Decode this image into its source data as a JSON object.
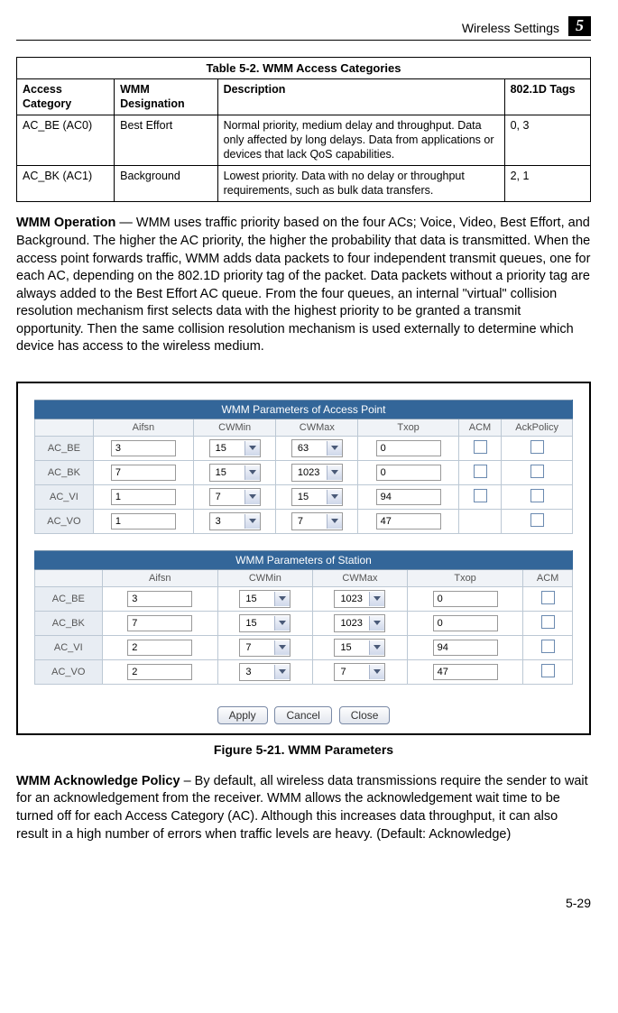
{
  "header": {
    "section_title": "Wireless Settings",
    "chapter_number": "5"
  },
  "table52": {
    "caption": "Table 5-2. WMM Access Categories",
    "headers": [
      "Access Category",
      "WMM Designation",
      "Description",
      "802.1D Tags"
    ],
    "rows": [
      {
        "category": "AC_BE (AC0)",
        "designation": "Best Effort",
        "description": "Normal priority, medium delay and throughput. Data only affected by long delays. Data from applications or devices that lack QoS capabilities.",
        "tags": "0, 3"
      },
      {
        "category": "AC_BK (AC1)",
        "designation": "Background",
        "description": "Lowest priority. Data with no delay or throughput requirements, such as bulk data transfers.",
        "tags": "2, 1"
      }
    ]
  },
  "para1": {
    "heading": "WMM Operation",
    "text": " — WMM uses traffic priority based on the four ACs; Voice, Video, Best Effort, and Background. The higher the AC priority, the higher the probability that data is transmitted. When the access point forwards traffic, WMM adds data packets to four independent transmit queues, one for each AC, depending on the 802.1D priority tag of the packet. Data packets without a priority tag are always added to the Best Effort AC queue. From the four queues, an internal \"virtual\" collision resolution mechanism first selects data with the highest priority to be granted a transmit opportunity. Then the same collision resolution mechanism is used externally to determine which device has access to the wireless medium."
  },
  "figure": {
    "caption": "Figure 5-21.   WMM Parameters",
    "ap": {
      "title": "WMM Parameters of Access Point",
      "headers": [
        "",
        "Aifsn",
        "CWMin",
        "CWMax",
        "Txop",
        "ACM",
        "AckPolicy"
      ],
      "rows": [
        {
          "label": "AC_BE",
          "aifsn": "3",
          "cwmin": "15",
          "cwmax": "63",
          "txop": "0"
        },
        {
          "label": "AC_BK",
          "aifsn": "7",
          "cwmin": "15",
          "cwmax": "1023",
          "txop": "0"
        },
        {
          "label": "AC_VI",
          "aifsn": "1",
          "cwmin": "7",
          "cwmax": "15",
          "txop": "94"
        },
        {
          "label": "AC_VO",
          "aifsn": "1",
          "cwmin": "3",
          "cwmax": "7",
          "txop": "47"
        }
      ]
    },
    "sta": {
      "title": "WMM Parameters of Station",
      "headers": [
        "",
        "Aifsn",
        "CWMin",
        "CWMax",
        "Txop",
        "ACM"
      ],
      "rows": [
        {
          "label": "AC_BE",
          "aifsn": "3",
          "cwmin": "15",
          "cwmax": "1023",
          "txop": "0"
        },
        {
          "label": "AC_BK",
          "aifsn": "7",
          "cwmin": "15",
          "cwmax": "1023",
          "txop": "0"
        },
        {
          "label": "AC_VI",
          "aifsn": "2",
          "cwmin": "7",
          "cwmax": "15",
          "txop": "94"
        },
        {
          "label": "AC_VO",
          "aifsn": "2",
          "cwmin": "3",
          "cwmax": "7",
          "txop": "47"
        }
      ]
    },
    "buttons": {
      "apply": "Apply",
      "cancel": "Cancel",
      "close": "Close"
    }
  },
  "para2": {
    "heading": "WMM Acknowledge Policy",
    "text": " – By default, all wireless data transmissions require the sender to wait for an acknowledgement from the receiver. WMM allows the acknowledgement wait time to be turned off for each Access Category (AC). Although this increases data throughput, it can also result in a high number of errors when traffic levels are heavy. (Default: Acknowledge)"
  },
  "page_number": "5-29"
}
